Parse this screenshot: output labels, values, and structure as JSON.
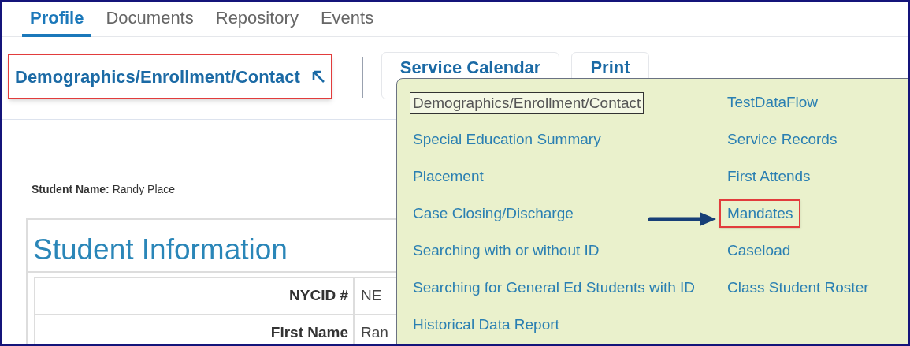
{
  "tabs": [
    {
      "label": "Profile",
      "selected": true
    },
    {
      "label": "Documents",
      "selected": false
    },
    {
      "label": "Repository",
      "selected": false
    },
    {
      "label": "Events",
      "selected": false
    }
  ],
  "section_button": {
    "label": "Demographics/Enrollment/Contact",
    "highlighted": true
  },
  "action_buttons": [
    "Service Calendar",
    "Print"
  ],
  "student_name": {
    "label": "Student Name:",
    "value": "Randy Place"
  },
  "student_information": {
    "title": "Student Information",
    "rows": [
      {
        "label": "NYCID #",
        "value": "NE"
      },
      {
        "label": "First Name",
        "value": "Ran"
      }
    ]
  },
  "menu": {
    "columns": [
      [
        {
          "label": "Demographics/Enrollment/Contact",
          "selected": true,
          "highlighted": false
        },
        {
          "label": "Special Education Summary",
          "selected": false,
          "highlighted": false
        },
        {
          "label": "Placement",
          "selected": false,
          "highlighted": false
        },
        {
          "label": "Case Closing/Discharge",
          "selected": false,
          "highlighted": false
        },
        {
          "label": "Searching with or without ID",
          "selected": false,
          "highlighted": false
        },
        {
          "label": "Searching for General Ed Students with ID",
          "selected": false,
          "highlighted": false
        },
        {
          "label": "Historical Data Report",
          "selected": false,
          "highlighted": false
        }
      ],
      [
        {
          "label": "TestDataFlow",
          "selected": false,
          "highlighted": false
        },
        {
          "label": "Service Records",
          "selected": false,
          "highlighted": false
        },
        {
          "label": "First Attends",
          "selected": false,
          "highlighted": false
        },
        {
          "label": "Mandates",
          "selected": false,
          "highlighted": true
        },
        {
          "label": "Caseload",
          "selected": false,
          "highlighted": false
        },
        {
          "label": "Class Student Roster",
          "selected": false,
          "highlighted": false
        }
      ]
    ]
  }
}
